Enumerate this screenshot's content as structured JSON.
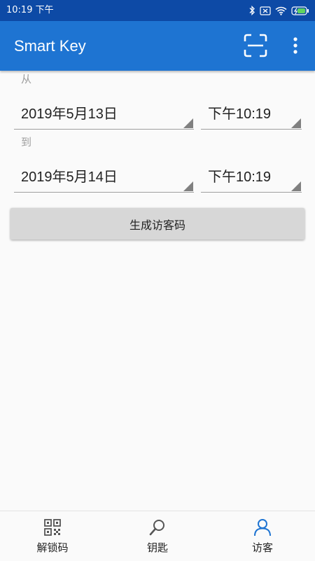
{
  "status_bar": {
    "time": "10:19 下午"
  },
  "app_bar": {
    "title": "Smart Key"
  },
  "form": {
    "from_label": "从",
    "from_date": "2019年5月13日",
    "from_time": "下午10:19",
    "to_label": "到",
    "to_date": "2019年5月14日",
    "to_time": "下午10:19",
    "generate_label": "生成访客码"
  },
  "bottom_nav": {
    "items": [
      {
        "label": "解锁码",
        "icon": "qr-code-icon"
      },
      {
        "label": "钥匙",
        "icon": "key-search-icon"
      },
      {
        "label": "访客",
        "icon": "person-icon"
      }
    ],
    "active_index": 2
  },
  "colors": {
    "status_bar": "#0d4aa6",
    "app_bar": "#1e74d2",
    "active_icon": "#1e74d2"
  }
}
